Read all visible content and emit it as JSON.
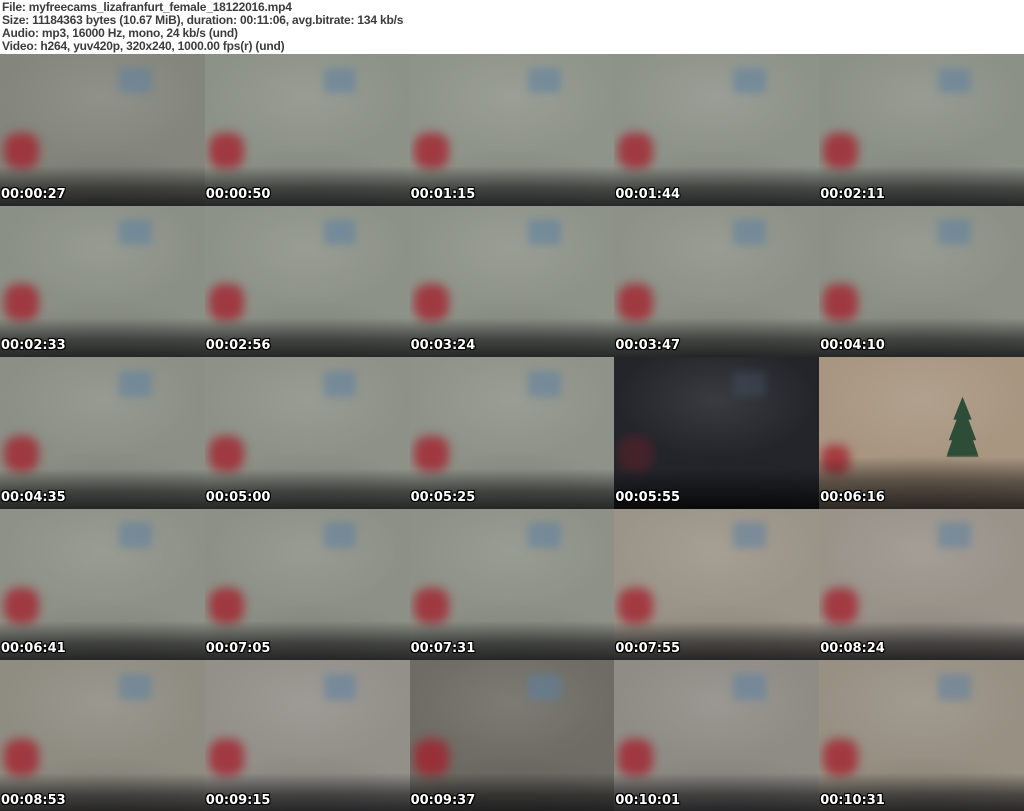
{
  "header": {
    "file_line": "File: myfreecams_lizafranfurt_female_18122016.mp4",
    "size_line": "Size: 11184363 bytes (10.67 MiB), duration: 00:11:06, avg.bitrate: 134 kb/s",
    "audio_line": "Audio: mp3, 16000 Hz, mono, 24 kb/s (und)",
    "video_line": "Video: h264, yuv420p, 320x240, 1000.00 fps(r) (und)"
  },
  "palette": {
    "header_bg": "#ffffff",
    "header_text": "#3c3c3c",
    "timestamp_text": "#ffffff",
    "timestamp_outline": "#000000",
    "pillow_red": "#a51d2a",
    "wall_art_blue": "#5d80a0",
    "couch_dark": "#17171a",
    "tree_green": "#2e4d38",
    "tree_star_red": "#b02030"
  },
  "grid": {
    "columns": 5,
    "rows": 5,
    "thumb_width": 205,
    "thumb_height": 152
  },
  "thumbnails": [
    {
      "time": "00:00:27",
      "base": "#84857c",
      "variant": "closeup"
    },
    {
      "time": "00:00:50",
      "base": "#8d9288",
      "variant": "closeup"
    },
    {
      "time": "00:01:15",
      "base": "#8f948a",
      "variant": "closeup"
    },
    {
      "time": "00:01:44",
      "base": "#8e938a",
      "variant": "closeup"
    },
    {
      "time": "00:02:11",
      "base": "#8c9187",
      "variant": "closeup"
    },
    {
      "time": "00:02:33",
      "base": "#8b9086",
      "variant": "closeup"
    },
    {
      "time": "00:02:56",
      "base": "#8d9288",
      "variant": "closeup"
    },
    {
      "time": "00:03:24",
      "base": "#8e9389",
      "variant": "closeup"
    },
    {
      "time": "00:03:47",
      "base": "#8d9187",
      "variant": "closeup"
    },
    {
      "time": "00:04:10",
      "base": "#8c9086",
      "variant": "closeup"
    },
    {
      "time": "00:04:35",
      "base": "#8b8f85",
      "variant": "closeup"
    },
    {
      "time": "00:05:00",
      "base": "#8d9187",
      "variant": "closeup"
    },
    {
      "time": "00:05:25",
      "base": "#8e9288",
      "variant": "closeup"
    },
    {
      "time": "00:05:55",
      "base": "#23252b",
      "variant": "dark"
    },
    {
      "time": "00:06:16",
      "base": "#a89681",
      "variant": "room"
    },
    {
      "time": "00:06:41",
      "base": "#8e9187",
      "variant": "closeup"
    },
    {
      "time": "00:07:05",
      "base": "#8d9086",
      "variant": "closeup"
    },
    {
      "time": "00:07:31",
      "base": "#8e9187",
      "variant": "closeup"
    },
    {
      "time": "00:07:55",
      "base": "#9b9488",
      "variant": "closeup"
    },
    {
      "time": "00:08:24",
      "base": "#99938a",
      "variant": "closeup"
    },
    {
      "time": "00:08:53",
      "base": "#8f8d82",
      "variant": "closeup"
    },
    {
      "time": "00:09:15",
      "base": "#93908a",
      "variant": "closeup"
    },
    {
      "time": "00:09:37",
      "base": "#6e6c64",
      "variant": "closeup"
    },
    {
      "time": "00:10:01",
      "base": "#8f8c86",
      "variant": "closeup"
    },
    {
      "time": "00:10:31",
      "base": "#979083",
      "variant": "closeup"
    }
  ]
}
